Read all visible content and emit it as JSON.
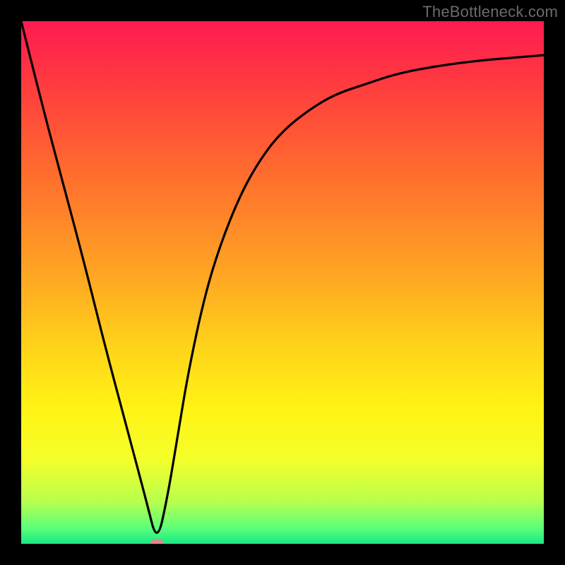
{
  "watermark": "TheBottleneck.com",
  "chart_data": {
    "type": "line",
    "title": "",
    "xlabel": "",
    "ylabel": "",
    "xlim": [
      0,
      100
    ],
    "ylim": [
      0,
      100
    ],
    "grid": false,
    "legend": false,
    "background_gradient": {
      "stops": [
        {
          "offset": 0.0,
          "color": "#ff1a52"
        },
        {
          "offset": 0.12,
          "color": "#ff3b3f"
        },
        {
          "offset": 0.3,
          "color": "#ff6f2d"
        },
        {
          "offset": 0.48,
          "color": "#ffa423"
        },
        {
          "offset": 0.62,
          "color": "#ffd21a"
        },
        {
          "offset": 0.74,
          "color": "#fff314"
        },
        {
          "offset": 0.84,
          "color": "#f4ff2a"
        },
        {
          "offset": 0.92,
          "color": "#b6ff4e"
        },
        {
          "offset": 0.97,
          "color": "#5cff7a"
        },
        {
          "offset": 1.0,
          "color": "#17e884"
        }
      ]
    },
    "marker": {
      "x": 26,
      "y": 0,
      "color": "#d88a8a"
    },
    "series": [
      {
        "name": "curve",
        "color": "#000000",
        "x": [
          0,
          4,
          8,
          12,
          16,
          20,
          24,
          26,
          28,
          30,
          32,
          35,
          38,
          42,
          46,
          50,
          55,
          60,
          66,
          72,
          80,
          88,
          94,
          100
        ],
        "y": [
          100,
          84,
          69,
          54,
          38,
          23,
          8,
          0,
          9,
          21,
          33,
          47,
          57,
          67,
          74,
          79,
          83,
          86,
          88,
          90,
          91.5,
          92.5,
          93,
          93.5
        ]
      }
    ]
  }
}
